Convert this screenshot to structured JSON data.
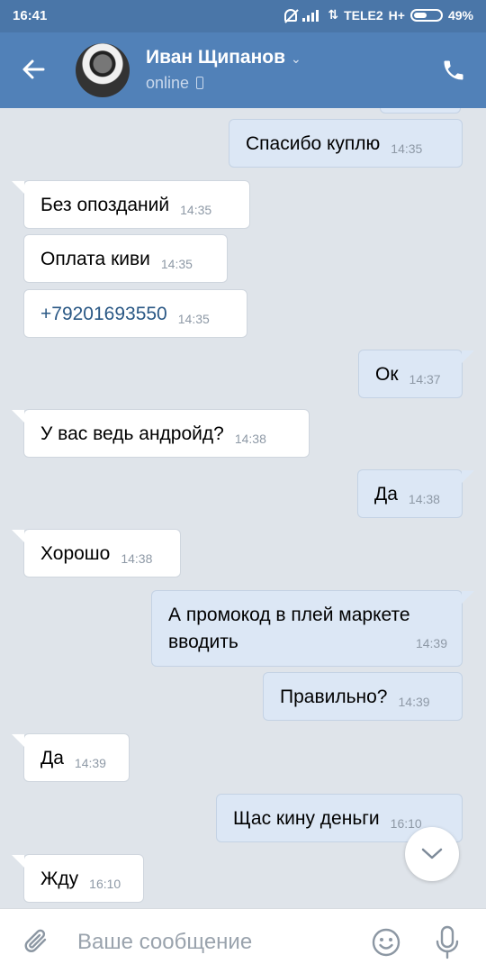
{
  "statusbar": {
    "time": "16:41",
    "carrier": "TELE2",
    "network": "H+",
    "battery": "49%",
    "battery_level": 0.49
  },
  "header": {
    "contact_name": "Иван Щипанов",
    "contact_status": "online",
    "accent_color": "#5181b8"
  },
  "messages": [
    {
      "dir": "out",
      "text": "Спасибо куплю",
      "time": "14:35"
    },
    {
      "dir": "in",
      "text": "Без опозданий",
      "time": "14:35"
    },
    {
      "dir": "in",
      "text": "Оплата киви",
      "time": "14:35"
    },
    {
      "dir": "in",
      "text": "+79201693550",
      "time": "14:35"
    },
    {
      "dir": "out",
      "text": "Ок",
      "time": "14:37"
    },
    {
      "dir": "in",
      "text": "У вас ведь андройд?",
      "time": "14:38"
    },
    {
      "dir": "out",
      "text": "Да",
      "time": "14:38"
    },
    {
      "dir": "in",
      "text": "Хорошо",
      "time": "14:38"
    },
    {
      "dir": "out",
      "text": "А промокод в плей маркете вводить",
      "time": "14:39"
    },
    {
      "dir": "out",
      "text": "Правильно?",
      "time": "14:39"
    },
    {
      "dir": "in",
      "text": "Да",
      "time": "14:39"
    },
    {
      "dir": "out",
      "text": "Щас кину деньги",
      "time": "16:10"
    },
    {
      "dir": "in",
      "text": "Жду",
      "time": "16:10"
    }
  ],
  "composer": {
    "placeholder": "Ваше сообщение"
  },
  "icons": [
    "back-arrow-icon",
    "chevron-down-icon",
    "phone-device-icon",
    "call-icon",
    "paperclip-icon",
    "emoji-icon",
    "microphone-icon",
    "scroll-down-icon"
  ]
}
